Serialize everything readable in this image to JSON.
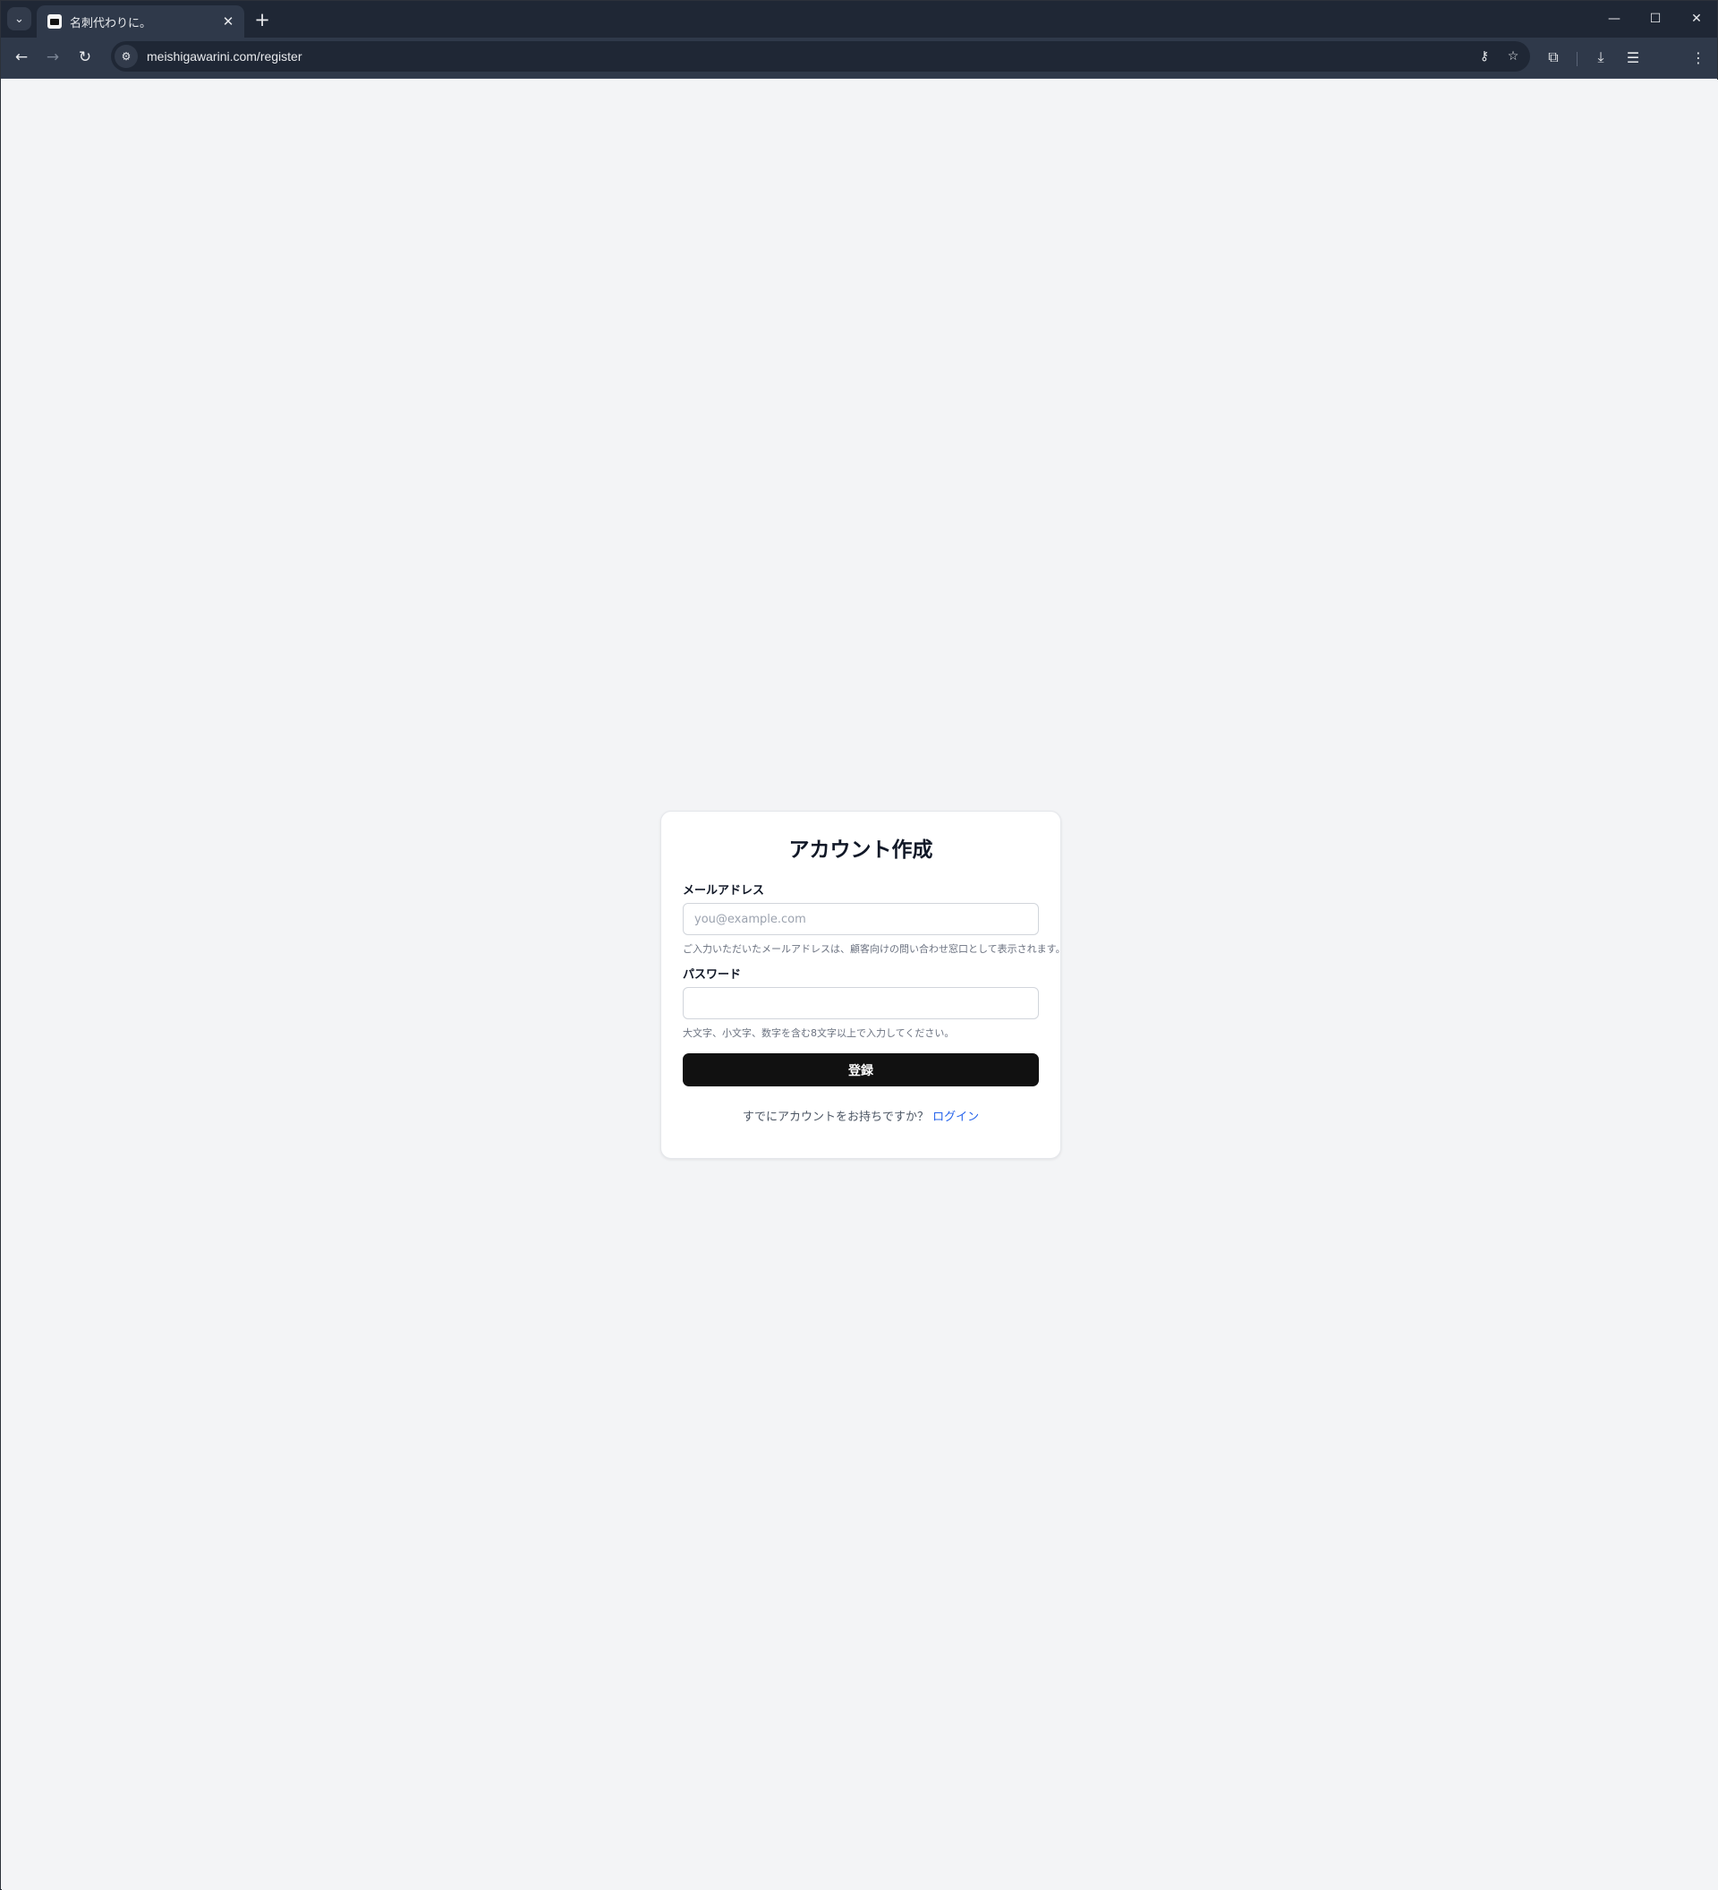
{
  "browser": {
    "tab": {
      "title": "名刺代わりに。",
      "close_glyph": "✕"
    },
    "new_tab_glyph": "+",
    "tab_search_glyph": "⌄",
    "window_controls": {
      "minimize": "—",
      "maximize": "☐",
      "close": "✕"
    },
    "nav": {
      "back": "←",
      "forward": "→",
      "reload": "↻"
    },
    "omnibox": {
      "url": "meishigawarini.com/register",
      "site_info_glyph": "⚙"
    },
    "icons": {
      "password_key": "⚷",
      "bookmark_star": "☆",
      "extensions": "⧉",
      "downloads": "⤓",
      "reading_list": "☰",
      "menu": "⋮"
    }
  },
  "form": {
    "title": "アカウント作成",
    "email_label": "メールアドレス",
    "email_value": "",
    "email_placeholder": "you@example.com",
    "email_helper": "ご入力いただいたメールアドレスは、顧客向けの問い合わせ窓口として表示されます。",
    "password_label": "パスワード",
    "password_value": "",
    "password_helper": "大文字、小文字、数字を含む8文字以上で入力してください。",
    "submit_label": "登録",
    "footer_text": "すでにアカウントをお持ちですか？",
    "login_link": "ログイン"
  },
  "colors": {
    "page_background": "#f3f4f6",
    "button_background": "#111111",
    "link": "#2563eb",
    "browser_frame": "#1f2735"
  }
}
